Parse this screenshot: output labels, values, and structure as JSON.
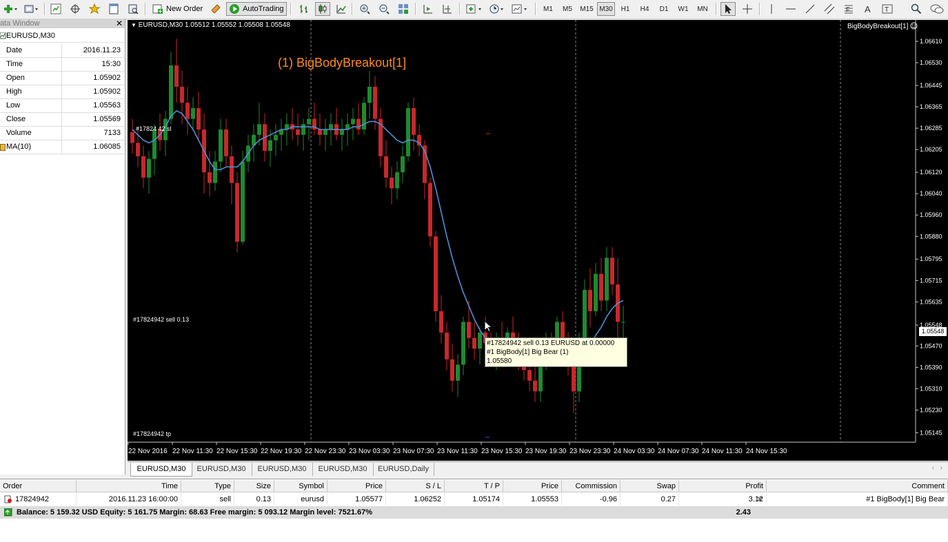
{
  "toolbar": {
    "new_order_label": "New Order",
    "autotrading_label": "AutoTrading",
    "timeframes": [
      "M1",
      "M5",
      "M15",
      "M30",
      "H1",
      "H4",
      "D1",
      "W1",
      "MN"
    ],
    "active_timeframe": "M30"
  },
  "data_window": {
    "title": "Data Window",
    "symbol": "EURUSD,M30",
    "rows": [
      {
        "label": "Date",
        "value": "2016.11.23"
      },
      {
        "label": "Time",
        "value": "15:30"
      },
      {
        "label": "Open",
        "value": "1.05902"
      },
      {
        "label": "High",
        "value": "1.05902"
      },
      {
        "label": "Low",
        "value": "1.05563"
      },
      {
        "label": "Close",
        "value": "1.05569"
      },
      {
        "label": "Volume",
        "value": "7133"
      },
      {
        "label": "MA(10)",
        "value": "1.06085"
      }
    ]
  },
  "chart": {
    "header": "EURUSD,M30  1.05512 1.05552 1.05508 1.05548",
    "indicator_name": "BigBodyBreakout[1]",
    "ea_label": "(1) BigBodyBreakout[1]",
    "bid_line_label": "#17824942 sell 0.13",
    "sl_line_label": "#17824 42 sl",
    "tp_line_label": "#17824942 tp",
    "current_price": "1.05548",
    "tooltip": {
      "line1": "#17824942 sell 0.13 EURUSD at 0.00000",
      "line2": "#1 BigBody[1] Big Bear (1)",
      "line3": "1.05580"
    },
    "colors": {
      "bull": "#1e8a2e",
      "bear": "#c8282a",
      "ma": "#4f8fd6",
      "axis_text": "#ffffff",
      "ea_label": "#ff8c1a"
    }
  },
  "chart_data": {
    "type": "candlestick",
    "symbol": "EURUSD",
    "timeframe": "M30",
    "ylim": [
      1.0511,
      1.0669
    ],
    "y_ticks": [
      "1.06610",
      "1.06530",
      "1.06445",
      "1.06365",
      "1.06285",
      "1.06205",
      "1.06120",
      "1.06040",
      "1.05960",
      "1.05880",
      "1.05795",
      "1.05715",
      "1.05635",
      "1.05548",
      "1.05470",
      "1.05390",
      "1.05310",
      "1.05230",
      "1.05145"
    ],
    "x_ticks": [
      "22 Nov 2016",
      "22 Nov 11:30",
      "22 Nov 15:30",
      "22 Nov 19:30",
      "22 Nov 23:30",
      "23 Nov 03:30",
      "23 Nov 07:30",
      "23 Nov 11:30",
      "23 Nov 15:30",
      "23 Nov 19:30",
      "23 Nov 23:30",
      "24 Nov 03:30",
      "24 Nov 07:30",
      "24 Nov 11:30",
      "24 Nov 15:30"
    ],
    "ohlc": [
      [
        1.0627,
        1.0632,
        1.0619,
        1.0623
      ],
      [
        1.0623,
        1.0629,
        1.0614,
        1.0618
      ],
      [
        1.0618,
        1.0622,
        1.0606,
        1.061
      ],
      [
        1.061,
        1.062,
        1.0604,
        1.0617
      ],
      [
        1.0617,
        1.063,
        1.0611,
        1.0628
      ],
      [
        1.0628,
        1.0634,
        1.062,
        1.0624
      ],
      [
        1.0624,
        1.0635,
        1.0618,
        1.0632
      ],
      [
        1.0632,
        1.0657,
        1.063,
        1.0652
      ],
      [
        1.0652,
        1.0662,
        1.0638,
        1.0644
      ],
      [
        1.0644,
        1.065,
        1.063,
        1.0638
      ],
      [
        1.0638,
        1.0644,
        1.0626,
        1.0632
      ],
      [
        1.0632,
        1.064,
        1.0628,
        1.0636
      ],
      [
        1.0636,
        1.0642,
        1.0624,
        1.0628
      ],
      [
        1.0628,
        1.0634,
        1.0604,
        1.0612
      ],
      [
        1.0612,
        1.062,
        1.0603,
        1.0608
      ],
      [
        1.0608,
        1.062,
        1.0605,
        1.0616
      ],
      [
        1.0616,
        1.0632,
        1.0612,
        1.0628
      ],
      [
        1.0628,
        1.0632,
        1.0614,
        1.0618
      ],
      [
        1.0618,
        1.0622,
        1.06,
        1.0608
      ],
      [
        1.0608,
        1.0612,
        1.0582,
        1.0586
      ],
      [
        1.0586,
        1.062,
        1.0585,
        1.0616
      ],
      [
        1.0616,
        1.0626,
        1.0612,
        1.0622
      ],
      [
        1.0622,
        1.063,
        1.0616,
        1.0626
      ],
      [
        1.0626,
        1.0638,
        1.0622,
        1.063
      ],
      [
        1.063,
        1.0634,
        1.0616,
        1.062
      ],
      [
        1.062,
        1.0628,
        1.0614,
        1.0624
      ],
      [
        1.0624,
        1.063,
        1.0618,
        1.0626
      ],
      [
        1.0626,
        1.0632,
        1.062,
        1.0628
      ],
      [
        1.0628,
        1.0634,
        1.0622,
        1.063
      ],
      [
        1.063,
        1.0636,
        1.0624,
        1.0628
      ],
      [
        1.0628,
        1.0634,
        1.0622,
        1.0626
      ],
      [
        1.0626,
        1.0632,
        1.062,
        1.063
      ],
      [
        1.063,
        1.0636,
        1.0624,
        1.0632
      ],
      [
        1.0632,
        1.0638,
        1.0626,
        1.0628
      ],
      [
        1.0628,
        1.0634,
        1.0622,
        1.0626
      ],
      [
        1.0626,
        1.0632,
        1.062,
        1.0628
      ],
      [
        1.0628,
        1.0634,
        1.0622,
        1.063
      ],
      [
        1.063,
        1.0636,
        1.0624,
        1.0626
      ],
      [
        1.0626,
        1.0632,
        1.062,
        1.0628
      ],
      [
        1.0628,
        1.0634,
        1.0622,
        1.063
      ],
      [
        1.063,
        1.0636,
        1.0624,
        1.0632
      ],
      [
        1.0632,
        1.0638,
        1.0626,
        1.0628
      ],
      [
        1.0628,
        1.064,
        1.0626,
        1.0638
      ],
      [
        1.0638,
        1.065,
        1.0632,
        1.0644
      ],
      [
        1.0644,
        1.0648,
        1.0628,
        1.0632
      ],
      [
        1.0632,
        1.0636,
        1.0614,
        1.0618
      ],
      [
        1.0618,
        1.0624,
        1.0606,
        1.061
      ],
      [
        1.061,
        1.0614,
        1.06,
        1.0606
      ],
      [
        1.0606,
        1.0616,
        1.0602,
        1.0612
      ],
      [
        1.0612,
        1.0622,
        1.0608,
        1.0618
      ],
      [
        1.0618,
        1.0638,
        1.0616,
        1.0636
      ],
      [
        1.0636,
        1.064,
        1.062,
        1.0626
      ],
      [
        1.0626,
        1.063,
        1.0618,
        1.0622
      ],
      [
        1.0622,
        1.0624,
        1.0602,
        1.0608
      ],
      [
        1.0608,
        1.061,
        1.0584,
        1.0588
      ],
      [
        1.0588,
        1.059,
        1.0556,
        1.056
      ],
      [
        1.056,
        1.0566,
        1.0548,
        1.0552
      ],
      [
        1.0552,
        1.0556,
        1.0538,
        1.0542
      ],
      [
        1.0542,
        1.0548,
        1.053,
        1.0534
      ],
      [
        1.0534,
        1.0544,
        1.0528,
        1.054
      ],
      [
        1.054,
        1.0558,
        1.0536,
        1.0556
      ],
      [
        1.0556,
        1.0564,
        1.0546,
        1.055
      ],
      [
        1.055,
        1.0556,
        1.0542,
        1.0546
      ],
      [
        1.0546,
        1.0554,
        1.054,
        1.0552
      ],
      [
        1.0552,
        1.0558,
        1.0544,
        1.0548
      ],
      [
        1.0548,
        1.0552,
        1.054,
        1.0544
      ],
      [
        1.0544,
        1.0552,
        1.0538,
        1.055
      ],
      [
        1.055,
        1.0556,
        1.0544,
        1.0546
      ],
      [
        1.0546,
        1.0554,
        1.054,
        1.0552
      ],
      [
        1.0552,
        1.0558,
        1.0546,
        1.0548
      ],
      [
        1.0548,
        1.0552,
        1.0538,
        1.0542
      ],
      [
        1.0542,
        1.0546,
        1.0534,
        1.0538
      ],
      [
        1.0538,
        1.0544,
        1.053,
        1.0534
      ],
      [
        1.0534,
        1.054,
        1.0526,
        1.053
      ],
      [
        1.053,
        1.0544,
        1.0526,
        1.0542
      ],
      [
        1.0542,
        1.0552,
        1.0538,
        1.0548
      ],
      [
        1.0548,
        1.0552,
        1.054,
        1.0544
      ],
      [
        1.0544,
        1.0558,
        1.054,
        1.0556
      ],
      [
        1.0556,
        1.056,
        1.0544,
        1.0548
      ],
      [
        1.0548,
        1.0552,
        1.0536,
        1.054
      ],
      [
        1.054,
        1.0546,
        1.0522,
        1.053
      ],
      [
        1.053,
        1.0552,
        1.0526,
        1.055
      ],
      [
        1.055,
        1.0572,
        1.0546,
        1.0568
      ],
      [
        1.0568,
        1.0576,
        1.0554,
        1.056
      ],
      [
        1.056,
        1.0578,
        1.0558,
        1.0574
      ],
      [
        1.0574,
        1.058,
        1.056,
        1.0564
      ],
      [
        1.0564,
        1.0584,
        1.056,
        1.058
      ],
      [
        1.058,
        1.0584,
        1.0566,
        1.057
      ],
      [
        1.057,
        1.058,
        1.055,
        1.0556
      ],
      [
        1.0556,
        1.0562,
        1.0544,
        1.0556
      ]
    ],
    "ma_period": 10,
    "ma": [
      1.0628,
      1.0626,
      1.0624,
      1.0623,
      1.0624,
      1.0626,
      1.0629,
      1.0633,
      1.0635,
      1.0634,
      1.0631,
      1.0628,
      1.0624,
      1.062,
      1.0616,
      1.0613,
      1.0613,
      1.0614,
      1.0614,
      1.0614,
      1.0616,
      1.0619,
      1.0622,
      1.0624,
      1.0625,
      1.0626,
      1.0627,
      1.0628,
      1.0628,
      1.0629,
      1.0629,
      1.0629,
      1.0629,
      1.0629,
      1.0628,
      1.0628,
      1.0628,
      1.0628,
      1.0628,
      1.0628,
      1.0629,
      1.0629,
      1.063,
      1.0631,
      1.0631,
      1.063,
      1.0628,
      1.0626,
      1.0624,
      1.0623,
      1.0624,
      1.0624,
      1.0623,
      1.062,
      1.0614,
      1.0606,
      1.0597,
      1.0588,
      1.058,
      1.0573,
      1.0567,
      1.0562,
      1.0557,
      1.0553,
      1.055,
      1.0548,
      1.0547,
      1.0546,
      1.0546,
      1.0546,
      1.0546,
      1.0545,
      1.0543,
      1.0541,
      1.054,
      1.054,
      1.054,
      1.054,
      1.0541,
      1.0541,
      1.054,
      1.0541,
      1.0544,
      1.0547,
      1.0551,
      1.0554,
      1.0558,
      1.0561,
      1.0563,
      1.0564
    ]
  },
  "tabs": [
    "EURUSD,M30",
    "EURUSD,M30",
    "EURUSD,M30",
    "EURUSD,M30",
    "EURUSD,Daily"
  ],
  "terminal": {
    "columns": [
      "Order",
      "Time",
      "Type",
      "Size",
      "Symbol",
      "Price",
      "S / L",
      "T / P",
      "Price",
      "Commission",
      "Swap",
      "Profit",
      "Comment"
    ],
    "order": {
      "order": "17824942",
      "time": "2016.11.23 16:00:00",
      "type": "sell",
      "size": "0.13",
      "symbol": "eurusd",
      "price": "1.05577",
      "sl": "1.06252",
      "tp": "1.05174",
      "current_price": "1.05553",
      "commission": "-0.96",
      "swap": "0.27",
      "profit": "3.12",
      "comment": "#1 BigBody[1] Big Bear"
    },
    "balance_text": "Balance: 5 159.32 USD  Equity: 5 161.75  Margin: 68.63  Free margin: 5 093.12  Margin level: 7521.67%",
    "total_profit": "2.43"
  }
}
